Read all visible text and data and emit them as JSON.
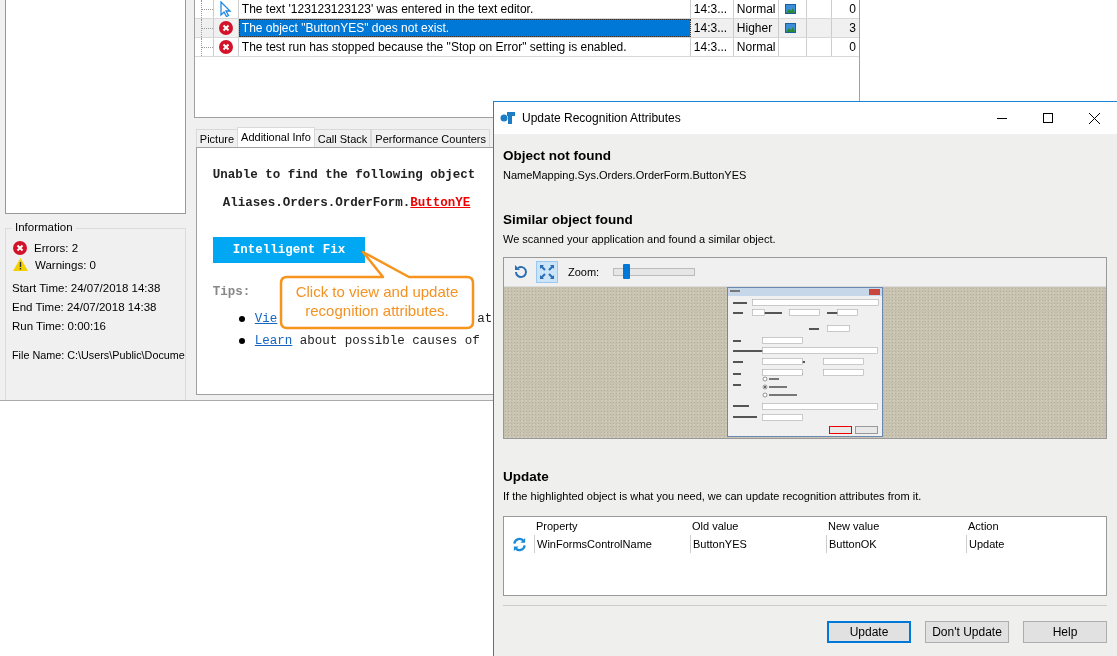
{
  "log_table": {
    "rows": [
      {
        "kind": "pointer",
        "message": "The text '123123123123' was entered in the text editor.",
        "time": "14:3...",
        "priority": "Normal",
        "has_picture": true,
        "count": "0",
        "selected": false
      },
      {
        "kind": "error",
        "message": "The object \"ButtonYES\" does not exist.",
        "time": "14:3...",
        "priority": "Higher",
        "has_picture": true,
        "count": "3",
        "selected": true
      },
      {
        "kind": "error",
        "message": "The test run has stopped because the \"Stop on Error\" setting is enabled.",
        "time": "14:3...",
        "priority": "Normal",
        "has_picture": false,
        "count": "0",
        "selected": false
      }
    ]
  },
  "information": {
    "title": "Information",
    "errors": "Errors: 2",
    "warnings": "Warnings: 0",
    "start_time": "Start Time: 24/07/2018 14:38",
    "end_time": "End Time: 24/07/2018 14:38",
    "run_time": "Run Time: 0:00:16",
    "file_name": "File Name: C:\\Users\\Public\\Docume"
  },
  "tabs": [
    {
      "label": "Picture",
      "selected": false
    },
    {
      "label": "Additional Info",
      "selected": true
    },
    {
      "label": "Call Stack",
      "selected": false
    },
    {
      "label": "Performance Counters",
      "selected": false
    }
  ],
  "additional_info": {
    "message": "Unable to find the following object",
    "alias_prefix": "Aliases.Orders.OrderForm.",
    "alias_object": "ButtonYE",
    "fix_button": "Intelligent Fix",
    "tips_title": "Tips:",
    "tip_1_link": "Vie",
    "tip_1_rest": "at",
    "tip_2_link": "Learn",
    "tip_2_rest": "about possible causes of"
  },
  "callout": {
    "text": "Click to view and update recognition attributes."
  },
  "dialog": {
    "title": "Update Recognition Attributes",
    "not_found_title": "Object not found",
    "not_found_path": "NameMapping.Sys.Orders.OrderForm.ButtonYES",
    "similar_title": "Similar object found",
    "similar_text": "We scanned your application and found a similar object.",
    "zoom_label": "Zoom:",
    "zoom": {
      "level": 0.15
    },
    "update_title": "Update",
    "update_text": "If the highlighted object is what you need, we can update recognition attributes from it.",
    "columns": [
      "Property",
      "Old value",
      "New value",
      "Action"
    ],
    "rows": [
      {
        "property": "WinFormsControlName",
        "old_value": "ButtonYES",
        "new_value": "ButtonOK",
        "action": "Update"
      }
    ],
    "buttons": [
      {
        "label": "Update",
        "default": true
      },
      {
        "label": "Don't Update",
        "default": false
      },
      {
        "label": "Help",
        "default": false
      }
    ]
  }
}
